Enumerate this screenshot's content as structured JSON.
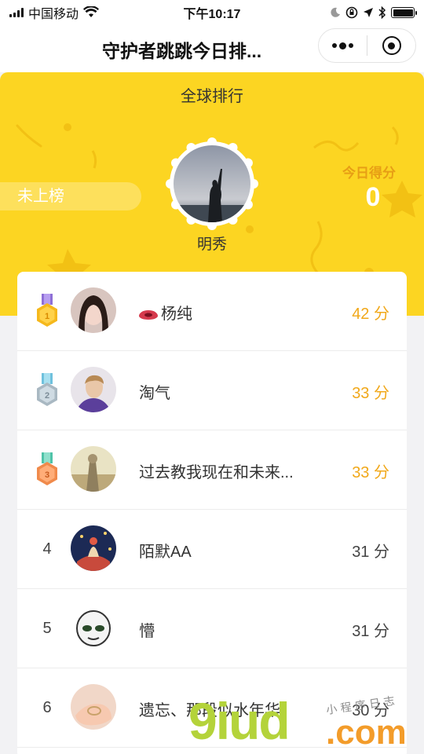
{
  "status_bar": {
    "carrier": "中国移动",
    "time": "下午10:17"
  },
  "nav": {
    "title": "守护者跳跳今日排..."
  },
  "header": {
    "global_rank_title": "全球排行",
    "unranked_label": "未上榜",
    "user_name": "明秀",
    "today_score_label": "今日得分",
    "today_score_value": "0"
  },
  "leaderboard": [
    {
      "rank": "1",
      "medal": "gold",
      "name": "杨纯",
      "has_lips_emoji": true,
      "score": "42 分"
    },
    {
      "rank": "2",
      "medal": "silver",
      "name": "淘气",
      "score": "33 分"
    },
    {
      "rank": "3",
      "medal": "bronze",
      "name": "过去教我现在和未来...",
      "score": "33 分"
    },
    {
      "rank": "4",
      "name": "陌默AA",
      "score": "31 分"
    },
    {
      "rank": "5",
      "name": "懵",
      "score": "31 分"
    },
    {
      "rank": "6",
      "name": "遗忘、那段似水年华",
      "score": "30 分"
    }
  ],
  "watermark": {
    "main": "9iud",
    "sub": ".com",
    "tag": "小 程 序 日 志"
  },
  "colors": {
    "header_yellow": "#fcd522",
    "score_orange": "#f1a81a",
    "gold": "#f5b81c",
    "silver": "#a9b8c2",
    "bronze": "#f08a4b"
  }
}
